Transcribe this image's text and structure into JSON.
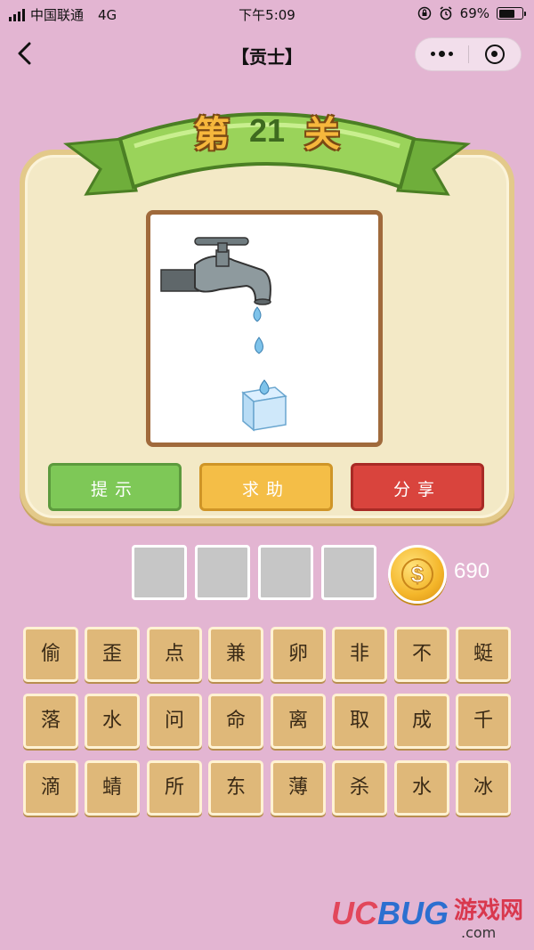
{
  "status_bar": {
    "carrier": "中国联通",
    "network": "4G",
    "time": "下午5:09",
    "battery_percent": "69%",
    "battery_level": 0.69
  },
  "nav": {
    "title": "【贡士】",
    "back_icon": "chevron-left-icon",
    "more_icon": "more-dots-icon",
    "close_icon": "target-close-icon"
  },
  "level": {
    "char1": "第",
    "number": "21",
    "char2": "关"
  },
  "picture": {
    "icons": [
      "water-tap-icon",
      "water-drop-icon",
      "ice-cube-icon"
    ]
  },
  "actions": {
    "hint": "提示",
    "help": "求助",
    "share": "分享"
  },
  "answer": {
    "slots": [
      "",
      "",
      "",
      ""
    ]
  },
  "coins": {
    "count": "690",
    "icon": "gold-coin-icon"
  },
  "letters": [
    [
      "偷",
      "歪",
      "点",
      "兼",
      "卵",
      "非",
      "不",
      "蜓"
    ],
    [
      "落",
      "水",
      "问",
      "命",
      "离",
      "取",
      "成",
      "千"
    ],
    [
      "滴",
      "蜻",
      "所",
      "东",
      "薄",
      "杀",
      "水",
      "冰"
    ]
  ],
  "watermark": {
    "brand_a": "UC",
    "brand_b": "BUG",
    "cn": "游戏网",
    "domain": ".com"
  },
  "colors": {
    "background": "#e3b5d2",
    "hint_button": "#7ec857",
    "help_button": "#f4be47",
    "share_button": "#d9443d",
    "letter_tile": "#dfb879"
  }
}
